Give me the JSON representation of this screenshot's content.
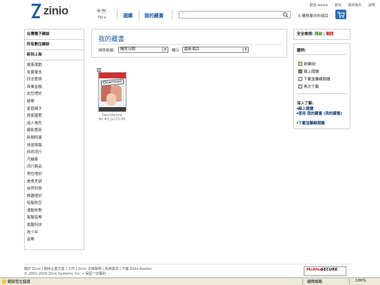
{
  "header": {
    "logo_text": "zinio",
    "logo_tm": "™",
    "region_label": "TW ▾",
    "nav": [
      "選購",
      "我的藏書"
    ],
    "search_placeholder": "\"",
    "top_links": [
      "歡迎 elaine",
      "登出",
      "我的帳戶",
      "說明"
    ],
    "cart_text": "0 購物車中的項目"
  },
  "sidebar": {
    "groups": [
      "台灣電子雜誌",
      "所有數位雜誌",
      "新到上架"
    ],
    "items": [
      "健康運動",
      "免費樣本",
      "同志愛情",
      "商業金融",
      "女性嗜好",
      "娛樂",
      "家庭親子",
      "居家園藝",
      "成人情色",
      "攝影藝術",
      "新聞時事",
      "旅遊情報",
      "時尚流行",
      "汽機車",
      "流行精品",
      "男性嗜好",
      "美食烹調",
      "自然科學",
      "興趣嗜好",
      "船艇航空",
      "運動休閒",
      "電腦音樂",
      "電腦科技",
      "青少年",
      "音樂"
    ]
  },
  "main": {
    "title": "我的藏書",
    "sort_label": "排序依據:",
    "sort_value": "購買日期",
    "show_label": "顯示",
    "show_value": "最新項目",
    "dropdown_arrow": "▾"
  },
  "magazine": {
    "cover_label": "Download",
    "name": "Demolanma",
    "issue": "No #0_Jul-01-09"
  },
  "right": {
    "security_label": "安全檢視:",
    "security_on": "開啟",
    "security_sep": "|",
    "security_off": "關閉",
    "legend_title": "圖例:",
    "legend_items": [
      "新雜誌!",
      "線上閱讀",
      "下載並離線閱讀",
      "再次下載"
    ],
    "learn_title": "深入了解:",
    "learn_items": [
      "線上閱讀",
      "使用 我的藏書 (我的藏書)",
      "下載並離線閱讀"
    ]
  },
  "footer": {
    "line1": "關於 Zinio | 關係企業方案 | 工作 | Zinio 法律聲明 | 系統需求 | 下載 Zinio Reader",
    "line2": "© 2001-2009 Zinio Systems, Inc. • 保留一切權利",
    "mcafee_brand": "McAfee",
    "mcafee_secure": "SECURE"
  },
  "statusbar": {
    "text": "網頁發生錯誤",
    "zone": "網際網路",
    "zoom": "100%"
  },
  "colors": {
    "link": "#1a58a3",
    "title": "#1a5ca6",
    "security_on": "#1d8a1d",
    "security_off": "#c41c1c",
    "cart": "#2b6fba"
  }
}
